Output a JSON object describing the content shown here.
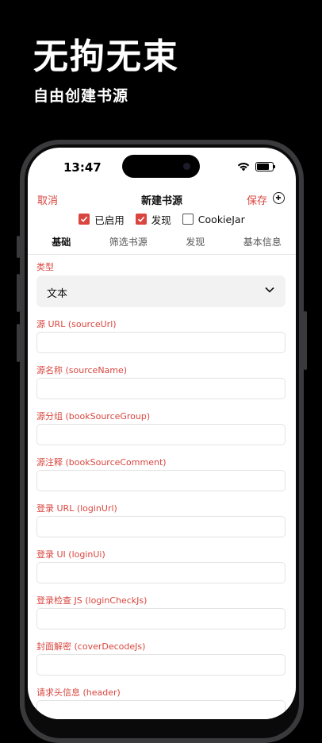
{
  "promo": {
    "title": "无拘无束",
    "subtitle": "自由创建书源"
  },
  "status_bar": {
    "time": "13:47"
  },
  "nav": {
    "cancel": "取消",
    "title": "新建书源",
    "save": "保存"
  },
  "checkboxes": [
    {
      "label": "已启用",
      "checked": true
    },
    {
      "label": "发现",
      "checked": true
    },
    {
      "label": "CookieJar",
      "checked": false
    }
  ],
  "tabs": [
    {
      "label": "基础",
      "active": true
    },
    {
      "label": "筛选书源",
      "active": false
    },
    {
      "label": "发现",
      "active": false
    },
    {
      "label": "基本信息",
      "active": false
    }
  ],
  "form": {
    "type_label": "类型",
    "type_value": "文本",
    "fields": [
      {
        "label": "源 URL (sourceUrl)",
        "value": ""
      },
      {
        "label": "源名称 (sourceName)",
        "value": ""
      },
      {
        "label": "源分组 (bookSourceGroup)",
        "value": ""
      },
      {
        "label": "源注释 (bookSourceComment)",
        "value": ""
      },
      {
        "label": "登录 URL (loginUrl)",
        "value": ""
      },
      {
        "label": "登录 UI (loginUi)",
        "value": ""
      },
      {
        "label": "登录检查 JS (loginCheckJs)",
        "value": ""
      },
      {
        "label": "封面解密 (coverDecodeJs)",
        "value": ""
      },
      {
        "label": "请求头信息 (header)",
        "value": ""
      }
    ]
  },
  "colors": {
    "accent": "#d9463f",
    "background": "#000000",
    "screen": "#ffffff"
  }
}
